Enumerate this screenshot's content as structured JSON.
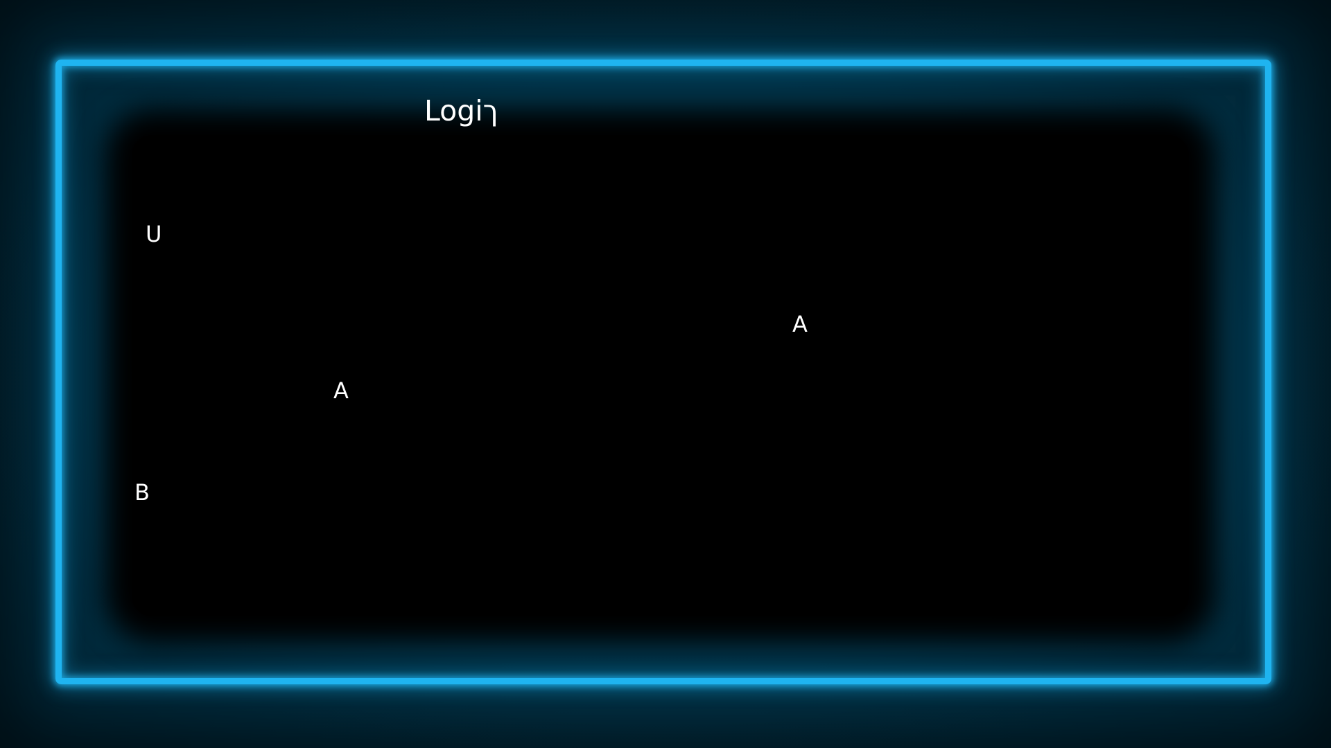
{
  "screen": {
    "title": "Logiך",
    "labels": {
      "u": "U",
      "a_left": "A",
      "a_right": "A",
      "b": "B"
    }
  },
  "colors": {
    "background": "#02354b",
    "frame_glow": "#1fb4f0",
    "panel": "#000000",
    "text": "#ffffff"
  }
}
